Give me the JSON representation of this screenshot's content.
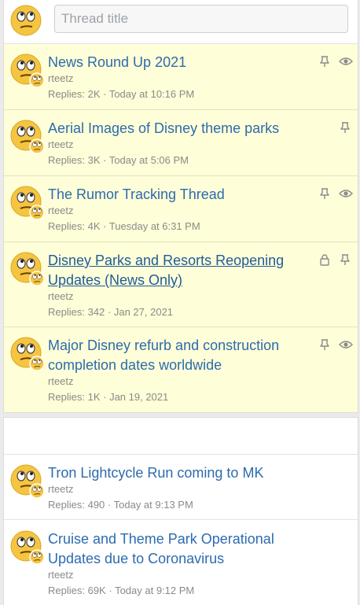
{
  "new_thread": {
    "placeholder": "Thread title"
  },
  "sticky_threads": [
    {
      "title": "News Round Up 2021",
      "author": "rteetz",
      "replies_label": "Replies:",
      "replies": "2K",
      "date": "Today at 10:16 PM",
      "icons": [
        "pin-icon",
        "eye-icon"
      ]
    },
    {
      "title": "Aerial Images of Disney theme parks",
      "author": "rteetz",
      "replies_label": "Replies:",
      "replies": "3K",
      "date": "Today at 5:06 PM",
      "icons": [
        "pin-icon"
      ]
    },
    {
      "title": "The Rumor Tracking Thread",
      "author": "rteetz",
      "replies_label": "Replies:",
      "replies": "4K",
      "date": "Tuesday at 6:31 PM",
      "icons": [
        "pin-icon",
        "eye-icon"
      ]
    },
    {
      "title": "Disney Parks and Resorts Reopening Updates (News Only)",
      "author": "rteetz",
      "replies_label": "Replies:",
      "replies": "342",
      "date": "Jan 27, 2021",
      "icons": [
        "lock-icon",
        "pin-icon"
      ]
    },
    {
      "title": "Major Disney refurb and construction completion dates worldwide",
      "author": "rteetz",
      "replies_label": "Replies:",
      "replies": "1K",
      "date": "Jan 19, 2021",
      "icons": [
        "pin-icon",
        "eye-icon"
      ]
    }
  ],
  "threads": [
    {
      "title": "Tron Lightcycle Run coming to MK",
      "author": "rteetz",
      "replies_label": "Replies:",
      "replies": "490",
      "date": "Today at 9:13 PM"
    },
    {
      "title": "Cruise and Theme Park Operational Updates due to Coronavirus",
      "author": "rteetz",
      "replies_label": "Replies:",
      "replies": "69K",
      "date": "Today at 9:12 PM"
    }
  ],
  "colors": {
    "link": "#2d6bae",
    "sticky_bg": "#fefed8",
    "meta_text": "#8a8a8a",
    "icon": "#8a8a8a"
  }
}
